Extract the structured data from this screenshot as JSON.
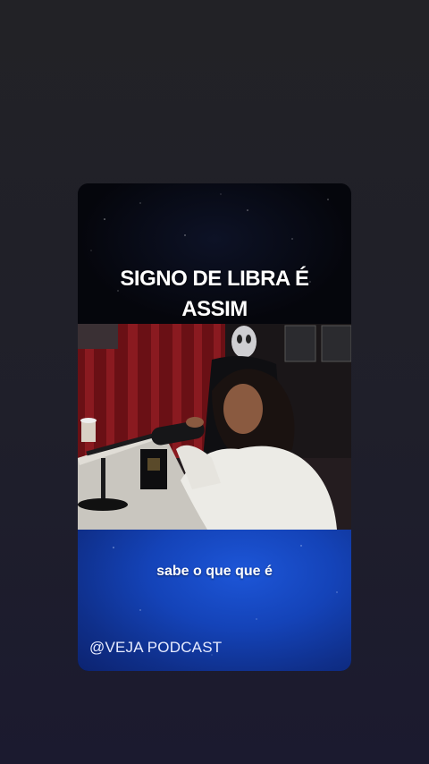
{
  "reel": {
    "headline": "SIGNO DE LIBRA É ASSIM",
    "caption": "sabe o que que é",
    "watermark": "@VEJA PODCAST"
  },
  "colors": {
    "page_background": "#1f1f2a",
    "caption_panel": "#1443b8",
    "text": "#ffffff"
  }
}
